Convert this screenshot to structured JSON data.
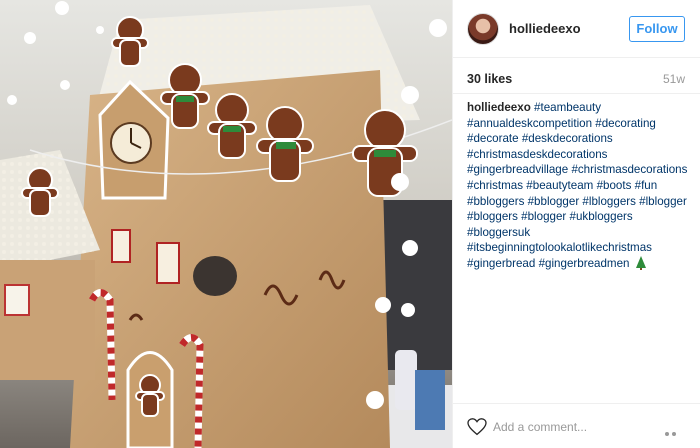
{
  "post": {
    "username": "holliedeexo",
    "follow_label": "Follow",
    "likes": "30 likes",
    "age": "51w",
    "caption": {
      "author": "holliedeexo",
      "tags": [
        "#teambeauty",
        "#annualdeskcompetition",
        "#decorating",
        "#decorate",
        "#deskdecorations",
        "#christmasdeskdecorations",
        "#gingerbreadvillage",
        "#christmasdecorations",
        "#christmas",
        "#beautyteam",
        "#boots",
        "#fun",
        "#bbloggers",
        "#bblogger",
        "#lbloggers",
        "#lblogger",
        "#bloggers",
        "#blogger",
        "#ukbloggers",
        "#bloggersuk",
        "#itsbeginningtolookalotlikechristmas",
        "#gingerbread",
        "#gingerbreadmen"
      ],
      "emoji": "christmas-tree-icon"
    },
    "comment_placeholder": "Add a comment...",
    "icons": {
      "heart": "heart-icon",
      "more": "more-options-icon"
    },
    "colors": {
      "follow_blue": "#3897f0",
      "hashtag": "#003569",
      "muted": "#999999"
    }
  }
}
